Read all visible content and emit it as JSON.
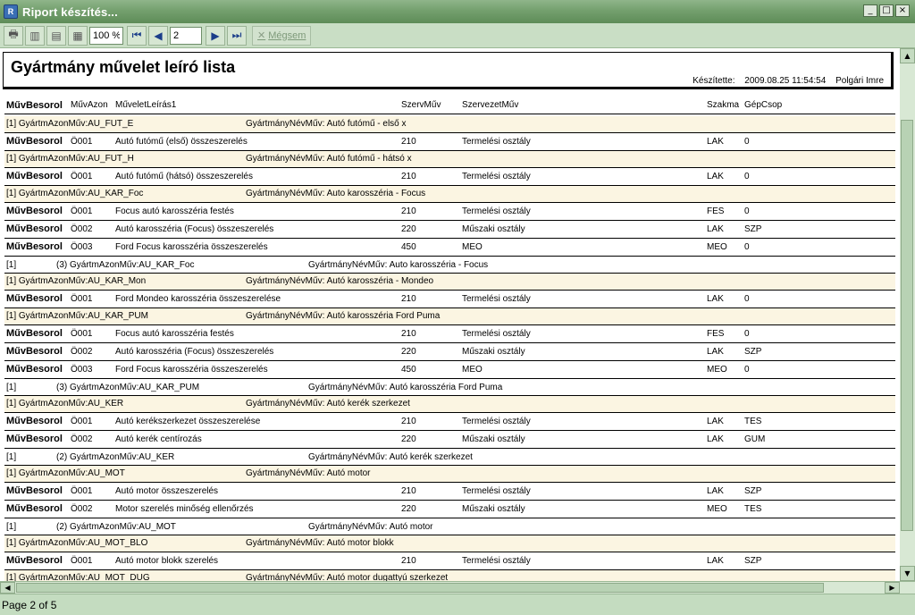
{
  "window": {
    "title": "Riport készítés...",
    "app_icon": "report-app-icon",
    "buttons": [
      "_",
      "□",
      "×"
    ]
  },
  "toolbar": {
    "zoom": "100 %",
    "page": "2",
    "cancel_label": "Mégsem",
    "icons": {
      "print": "🖶",
      "one_page": "▥",
      "two_pages": "▤",
      "multi_page": "▦",
      "first": "⏮",
      "prev": "◀",
      "next": "▶",
      "last": "⏭",
      "cancel": "✕"
    }
  },
  "report": {
    "title": "Gyártmány művelet leíró lista",
    "created_label": "Készítette:",
    "created_at": "2009.08.25 11:54:54",
    "author": "Polgári Imre",
    "columns": {
      "c1": "MűvBesorol",
      "c2": "MűvAzon",
      "c3": "MűveletLeírás1",
      "c4": "SzervMűv",
      "c5": "SzervezetMűv",
      "c6": "Szakma",
      "c7": "GépCsop"
    }
  },
  "rows": [
    {
      "type": "grp",
      "a": "[1] GyártmAzonMűv:AU_FUT_E",
      "b": "GyártmányNévMűv: Autó futómű - első x"
    },
    {
      "type": "det",
      "k": "MűvBesorol",
      "az": "Ö001",
      "desc": "Autó futómű (első) összeszerelés",
      "sz": "210",
      "org": "Termelési osztály",
      "skm": "LAK",
      "gep": "0"
    },
    {
      "type": "grp",
      "a": "[1] GyártmAzonMűv:AU_FUT_H",
      "b": "GyártmányNévMűv: Autó futómű - hátsó x"
    },
    {
      "type": "det",
      "k": "MűvBesorol",
      "az": "Ö001",
      "desc": "Autó futómű (hátsó) összeszerelés",
      "sz": "210",
      "org": "Termelési osztály",
      "skm": "LAK",
      "gep": "0"
    },
    {
      "type": "grp",
      "a": "[1] GyártmAzonMűv:AU_KAR_Foc",
      "b": "GyártmányNévMűv: Auto karosszéria - Focus"
    },
    {
      "type": "det",
      "k": "MűvBesorol",
      "az": "Ö001",
      "desc": "Focus autó karosszéria festés",
      "sz": "210",
      "org": "Termelési osztály",
      "skm": "FES",
      "gep": "0"
    },
    {
      "type": "det",
      "k": "MűvBesorol",
      "az": "Ö002",
      "desc": "Autó karosszéria (Focus) összeszerelés",
      "sz": "220",
      "org": "Műszaki osztály",
      "skm": "LAK",
      "gep": "SZP"
    },
    {
      "type": "det",
      "k": "MűvBesorol",
      "az": "Ö003",
      "desc": "Ford Focus karosszéria összeszerelés",
      "sz": "450",
      "org": "MEO",
      "skm": "MEO",
      "gep": "0"
    },
    {
      "type": "foot",
      "a": "[1]",
      "n": "(3) GyártmAzonMűv:AU_KAR_Foc",
      "b": "GyártmányNévMűv: Auto karosszéria - Focus"
    },
    {
      "type": "grp",
      "a": "[1] GyártmAzonMűv:AU_KAR_Mon",
      "b": "GyártmányNévMűv: Autó karosszéria - Mondeo"
    },
    {
      "type": "det",
      "k": "MűvBesorol",
      "az": "Ö001",
      "desc": "Ford Mondeo karosszéria összeszerelése",
      "sz": "210",
      "org": "Termelési osztály",
      "skm": "LAK",
      "gep": "0"
    },
    {
      "type": "grp",
      "a": "[1] GyártmAzonMűv:AU_KAR_PUM",
      "b": "GyártmányNévMűv: Autó karosszéria Ford Puma"
    },
    {
      "type": "det",
      "k": "MűvBesorol",
      "az": "Ö001",
      "desc": "Focus autó karosszéria festés",
      "sz": "210",
      "org": "Termelési osztály",
      "skm": "FES",
      "gep": "0"
    },
    {
      "type": "det",
      "k": "MűvBesorol",
      "az": "Ö002",
      "desc": "Autó karosszéria (Focus) összeszerelés",
      "sz": "220",
      "org": "Műszaki osztály",
      "skm": "LAK",
      "gep": "SZP"
    },
    {
      "type": "det",
      "k": "MűvBesorol",
      "az": "Ö003",
      "desc": "Ford Focus karosszéria összeszerelés",
      "sz": "450",
      "org": "MEO",
      "skm": "MEO",
      "gep": "0"
    },
    {
      "type": "foot",
      "a": "[1]",
      "n": "(3) GyártmAzonMűv:AU_KAR_PUM",
      "b": "GyártmányNévMűv: Autó karosszéria Ford Puma"
    },
    {
      "type": "grp",
      "a": "[1] GyártmAzonMűv:AU_KER",
      "b": "GyártmányNévMűv: Autó kerék szerkezet"
    },
    {
      "type": "det",
      "k": "MűvBesorol",
      "az": "Ö001",
      "desc": "Autó kerékszerkezet összeszerelése",
      "sz": "210",
      "org": "Termelési osztály",
      "skm": "LAK",
      "gep": "TES"
    },
    {
      "type": "det",
      "k": "MűvBesorol",
      "az": "Ö002",
      "desc": "Autó kerék centírozás",
      "sz": "220",
      "org": "Műszaki osztály",
      "skm": "LAK",
      "gep": "GUM"
    },
    {
      "type": "foot",
      "a": "[1]",
      "n": "(2) GyártmAzonMűv:AU_KER",
      "b": "GyártmányNévMűv: Autó kerék szerkezet"
    },
    {
      "type": "grp",
      "a": "[1] GyártmAzonMűv:AU_MOT",
      "b": "GyártmányNévMűv: Autó motor"
    },
    {
      "type": "det",
      "k": "MűvBesorol",
      "az": "Ö001",
      "desc": "Autó motor összeszerelés",
      "sz": "210",
      "org": "Termelési osztály",
      "skm": "LAK",
      "gep": "SZP"
    },
    {
      "type": "det",
      "k": "MűvBesorol",
      "az": "Ö002",
      "desc": "Motor szerelés minőség ellenőrzés",
      "sz": "220",
      "org": "Műszaki osztály",
      "skm": "MEO",
      "gep": "TES"
    },
    {
      "type": "foot",
      "a": "[1]",
      "n": "(2) GyártmAzonMűv:AU_MOT",
      "b": "GyártmányNévMűv: Autó motor"
    },
    {
      "type": "grp",
      "a": "[1] GyártmAzonMűv:AU_MOT_BLO",
      "b": "GyártmányNévMűv: Autó motor blokk"
    },
    {
      "type": "det",
      "k": "MűvBesorol",
      "az": "Ö001",
      "desc": "Autó motor blokk szerelés",
      "sz": "210",
      "org": "Termelési osztály",
      "skm": "LAK",
      "gep": "SZP"
    },
    {
      "type": "grp",
      "a": "[1] GyártmAzonMűv:AU_MOT_DUG",
      "b": "GyártmányNévMűv: Autó motor dugattyú szerkezet"
    }
  ],
  "status": {
    "page_text": "Page 2 of 5"
  }
}
